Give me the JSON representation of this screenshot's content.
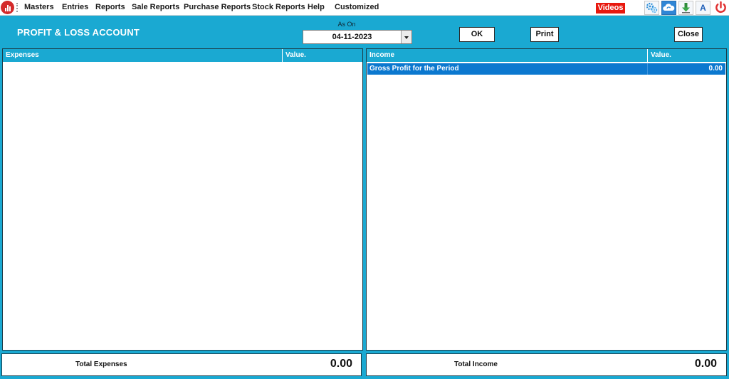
{
  "menu": {
    "items": [
      "Masters",
      "Entries",
      "Reports",
      "Sale Reports",
      "Purchase Reports",
      "Stock Reports",
      "Help",
      "Customized"
    ],
    "videos_label": "Videos",
    "font_button_label": "A"
  },
  "header": {
    "title": "PROFIT & LOSS ACCOUNT",
    "date_label": "As On",
    "date_value": "04-11-2023",
    "ok_label": "OK",
    "print_label": "Print",
    "close_label": "Close"
  },
  "expenses": {
    "col_name": "Expenses",
    "col_value": "Value.",
    "rows": []
  },
  "income": {
    "col_name": "Income",
    "col_value": "Value.",
    "rows": [
      {
        "name": "Gross Profit for the Period",
        "value": "0.00"
      }
    ]
  },
  "totals": {
    "expenses_label": "Total Expenses",
    "expenses_value": "0.00",
    "income_label": "Total Income",
    "income_value": "0.00"
  },
  "colors": {
    "accent": "#1aa9d2",
    "selection": "#0b78cf",
    "videos_badge": "#e8180e",
    "power": "#e03030"
  },
  "icons": [
    "app-logo-icon",
    "settings-gears-icon",
    "cloud-sync-icon",
    "download-icon",
    "font-icon",
    "power-icon"
  ]
}
